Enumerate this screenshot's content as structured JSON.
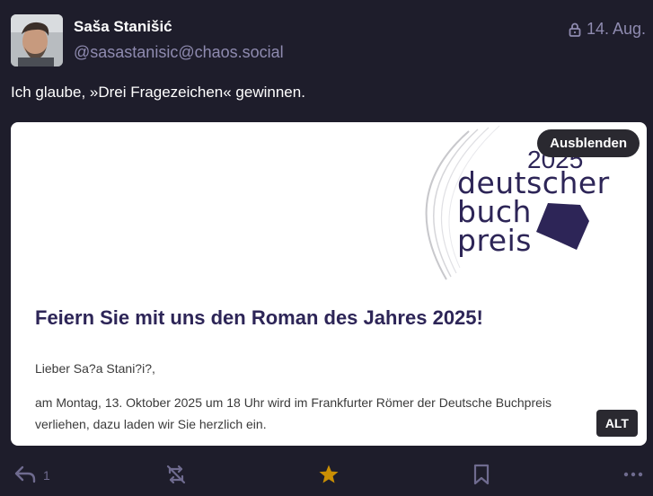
{
  "author": {
    "display_name": "Saša Stanišić",
    "handle": "@sasastanisic@chaos.social"
  },
  "meta": {
    "visibility_icon": "lock-icon",
    "date": "14. Aug."
  },
  "post": {
    "text": "Ich glaube, »Drei Fragezeichen« gewinnen."
  },
  "media": {
    "hide_label": "Ausblenden",
    "alt_label": "ALT",
    "logo": {
      "year": "2025",
      "line1": "deutscher",
      "line2": "buch",
      "line3": "preis"
    },
    "heading": "Feiern Sie mit uns den Roman des Jahres 2025!",
    "salutation": "Lieber Sa?a Stani?i?,",
    "body_line1": "am Montag, 13. Oktober 2025 um 18 Uhr wird im Frankfurter Römer der Deutsche Buchpreis",
    "body_line2": "verliehen, dazu laden wir Sie herzlich ein."
  },
  "actions": {
    "reply_count": "1",
    "icons": [
      "reply-icon",
      "boost-icon",
      "favourite-icon",
      "bookmark-icon",
      "more-icon"
    ],
    "favourite_color": "#ca8f04"
  },
  "colors": {
    "background": "#1e1d2b",
    "muted": "#8f8bb0",
    "brand": "#2d2557"
  }
}
